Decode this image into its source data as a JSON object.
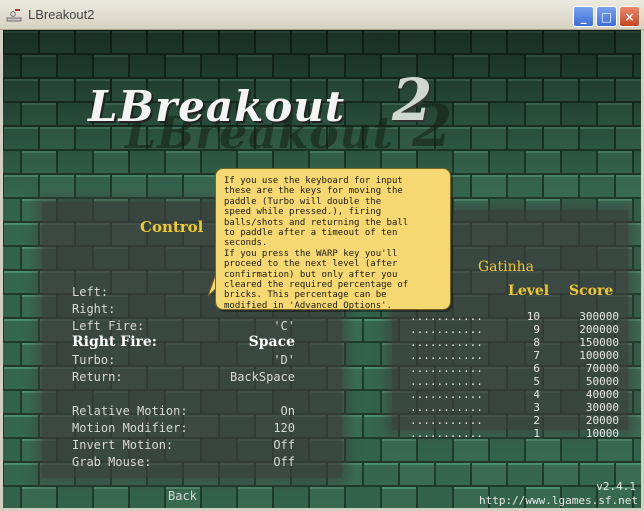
{
  "window": {
    "title": "LBreakout2",
    "minimize_glyph": "_",
    "maximize_glyph": "□",
    "close_glyph": "×"
  },
  "logo": {
    "text": "LBreakout",
    "number": "2"
  },
  "menu": {
    "title": "Control",
    "rows": [
      {
        "label": "Left:",
        "value": ""
      },
      {
        "label": "Right:",
        "value": ""
      },
      {
        "label": "Left Fire:",
        "value": "'C'"
      },
      {
        "label": "Right Fire:",
        "value": "Space",
        "selected": true
      },
      {
        "label": "Turbo:",
        "value": "'D'"
      },
      {
        "label": "Return:",
        "value": "BackSpace"
      },
      {
        "label": "Relative Motion:",
        "value": "On"
      },
      {
        "label": "Motion Modifier:",
        "value": "120"
      },
      {
        "label": "Invert Motion:",
        "value": "Off"
      },
      {
        "label": "Grab Mouse:",
        "value": "Off"
      }
    ],
    "back_label": "Back"
  },
  "tooltip": {
    "text": "If you use the keyboard for input\nthese are the keys for moving the\npaddle (Turbo will double the\nspeed while pressed.), firing\nballs/shots and returning the ball\nto paddle after a timeout of ten\nseconds.\nIf you press the WARP key you'll\nproceed to the next level (after\nconfirmation) but only after you\ncleared the required percentage of\nbricks. This percentage can be\nmodified in 'Advanced Options'."
  },
  "highscores": {
    "player": "Gatinha",
    "level_header": "Level",
    "score_header": "Score",
    "dots": "...........",
    "entries": [
      {
        "level": "10",
        "score": "300000"
      },
      {
        "level": "9",
        "score": "200000"
      },
      {
        "level": "8",
        "score": "150000"
      },
      {
        "level": "7",
        "score": "100000"
      },
      {
        "level": "6",
        "score": "70000"
      },
      {
        "level": "5",
        "score": "50000"
      },
      {
        "level": "4",
        "score": "40000"
      },
      {
        "level": "3",
        "score": "30000"
      },
      {
        "level": "2",
        "score": "20000"
      },
      {
        "level": "1",
        "score": "10000"
      }
    ]
  },
  "footer": {
    "version": "v2.4.1",
    "url": "http://www.lgames.sf.net"
  },
  "colors": {
    "accent_yellow": "#f0c830",
    "tooltip_bg": "#f5d872",
    "brick": "#2f5a44"
  }
}
